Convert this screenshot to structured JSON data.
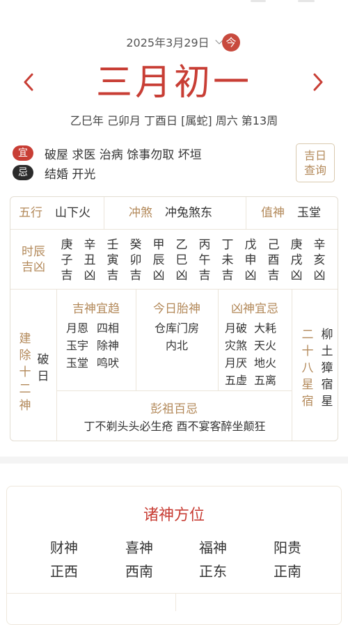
{
  "header": {
    "date_selector": "2025年3月29日",
    "today_button": "今",
    "lunar_date": "三月初一",
    "ganzhi_line": "乙巳年 己卯月 丁酉日 [属蛇] 周六 第13周"
  },
  "yiji": {
    "yi_badge": "宜",
    "yi_text": "破屋 求医 治病 馀事勿取 坏垣",
    "ji_badge": "忌",
    "ji_text": "结婚 开光",
    "jiri_button_line1": "吉日",
    "jiri_button_line2": "查询"
  },
  "almanac": {
    "wuxing_label": "五行",
    "wuxing_value": "山下火",
    "chongsha_label": "冲煞",
    "chongsha_value": "冲兔煞东",
    "zhishen_label": "值神",
    "zhishen_value": "玉堂",
    "shichen_label_1": "时辰",
    "shichen_label_2": "吉凶",
    "shichen": [
      {
        "gan": "庚",
        "zhi": "子",
        "luck": "吉"
      },
      {
        "gan": "辛",
        "zhi": "丑",
        "luck": "凶"
      },
      {
        "gan": "壬",
        "zhi": "寅",
        "luck": "吉"
      },
      {
        "gan": "癸",
        "zhi": "卯",
        "luck": "吉"
      },
      {
        "gan": "甲",
        "zhi": "辰",
        "luck": "凶"
      },
      {
        "gan": "乙",
        "zhi": "巳",
        "luck": "凶"
      },
      {
        "gan": "丙",
        "zhi": "午",
        "luck": "吉"
      },
      {
        "gan": "丁",
        "zhi": "未",
        "luck": "吉"
      },
      {
        "gan": "戊",
        "zhi": "申",
        "luck": "凶"
      },
      {
        "gan": "己",
        "zhi": "酉",
        "luck": "吉"
      },
      {
        "gan": "庚",
        "zhi": "戌",
        "luck": "凶"
      },
      {
        "gan": "辛",
        "zhi": "亥",
        "luck": "凶"
      }
    ],
    "jianchu_label": [
      "建",
      "除",
      "十",
      "二",
      "神"
    ],
    "jianchu_value": [
      "破",
      "日"
    ],
    "jishen_label": "吉神宜趋",
    "jishen_col1": [
      "月恩",
      "玉宇",
      "玉堂"
    ],
    "jishen_col2": [
      "四相",
      "除神",
      "鸣吠"
    ],
    "taishen_label": "今日胎神",
    "taishen_line1": "仓库门房",
    "taishen_line2": "内北",
    "xiongshen_label": "凶神宜忌",
    "xiongshen_col1": [
      "月破",
      "灾煞",
      "月厌",
      "五虚"
    ],
    "xiongshen_col2": [
      "大耗",
      "天火",
      "地火",
      "五离"
    ],
    "xiu_label": [
      "二",
      "十",
      "八",
      "星",
      "宿"
    ],
    "xiu_value": [
      "柳",
      "土",
      "獐",
      "宿",
      "星"
    ],
    "pengzu_label": "彭祖百忌",
    "pengzu_text": "丁不剃头头必生疮 酉不宴客醉坐颠狂"
  },
  "gods": {
    "title": "诸神方位",
    "items": [
      {
        "name": "财神",
        "direction": "正西"
      },
      {
        "name": "喜神",
        "direction": "西南"
      },
      {
        "name": "福神",
        "direction": "正东"
      },
      {
        "name": "阳贵",
        "direction": "正南"
      }
    ]
  },
  "colors": {
    "accent_red": "#c83e35",
    "gold_label": "#b3895a",
    "ji_black": "#2b2b2b"
  }
}
